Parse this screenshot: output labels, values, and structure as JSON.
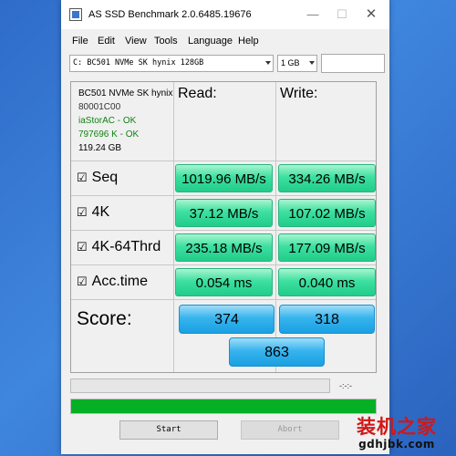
{
  "window": {
    "title": "AS SSD Benchmark 2.0.6485.19676",
    "minimize_glyph": "—",
    "maximize_glyph": "☐",
    "close_glyph": "✕"
  },
  "menu": [
    "File",
    "Edit",
    "View",
    "Tools",
    "Language",
    "Help"
  ],
  "toolbar": {
    "drive": "C: BC501 NVMe SK hynix 128GB",
    "size": "1 GB",
    "search_value": ""
  },
  "drive_info": {
    "model": "BC501 NVMe SK hynix",
    "firmware": "80001C00",
    "driver_status": "iaStorAC - OK",
    "alignment_status": "797696 K - OK",
    "capacity": "119.24 GB"
  },
  "columns": {
    "read": "Read:",
    "write": "Write:"
  },
  "rows": [
    {
      "checkbox": "☑",
      "label": "Seq",
      "read": "1019.96 MB/s",
      "write": "334.26 MB/s"
    },
    {
      "checkbox": "☑",
      "label": "4K",
      "read": "37.12 MB/s",
      "write": "107.02 MB/s"
    },
    {
      "checkbox": "☑",
      "label": "4K-64Thrd",
      "read": "235.18 MB/s",
      "write": "177.09 MB/s"
    },
    {
      "checkbox": "☑",
      "label": "Acc.time",
      "read": "0.054 ms",
      "write": "0.040 ms"
    }
  ],
  "score": {
    "label": "Score:",
    "read": "374",
    "write": "318",
    "total": "863"
  },
  "progress": {
    "elapsed": "-:-:-",
    "fraction": 1.0
  },
  "buttons": {
    "start": "Start",
    "abort": "Abort"
  },
  "watermark": {
    "chinese": "装机之家",
    "url": "gdhjbk.com"
  },
  "colors": {
    "result_green": "#3de0a0",
    "score_blue": "#37b4ee",
    "progress_green": "#06b025",
    "status_ok": "#128212",
    "watermark_red": "#d01818"
  },
  "icons": {
    "app": "app-window-icon",
    "dropdown": "chevron-down-icon",
    "checkbox": "checkbox-checked-icon"
  }
}
